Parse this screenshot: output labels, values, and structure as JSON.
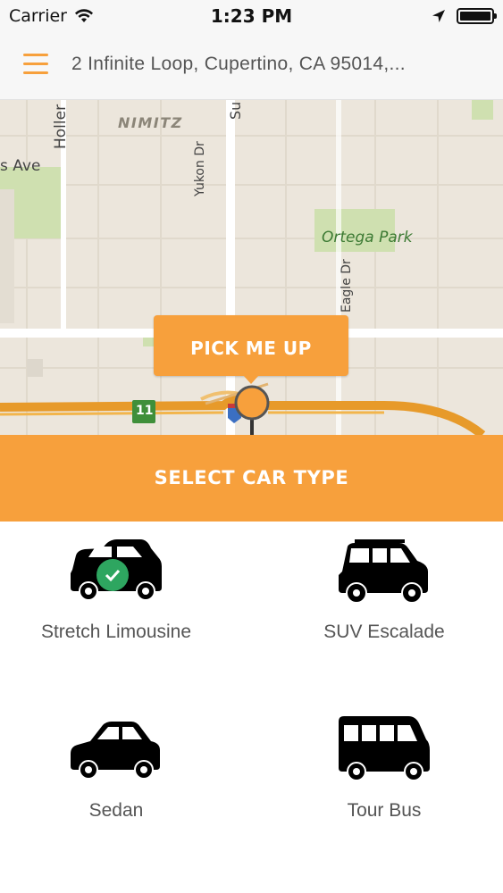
{
  "status_bar": {
    "carrier": "Carrier",
    "time": "1:23 PM"
  },
  "header": {
    "menu_icon": "hamburger-menu-icon",
    "address": "2 Infinite Loop, Cupertino, CA 95014,..."
  },
  "map": {
    "labels": {
      "holler": "Holler",
      "nimitz": "NIMITZ",
      "su": "Su",
      "s_ave": "s Ave",
      "yukon_dr": "Yukon Dr",
      "ortega_park": "Ortega Park",
      "eagle_dr": "Eagle Dr",
      "route_11": "11"
    },
    "pickup_button": "PICK ME UP"
  },
  "select_bar": {
    "label": "SELECT CAR TYPE"
  },
  "cars": [
    {
      "label": "Stretch Limousine",
      "icon": "limousine-icon",
      "selected": true
    },
    {
      "label": "SUV Escalade",
      "icon": "suv-icon",
      "selected": false
    },
    {
      "label": "Sedan",
      "icon": "sedan-icon",
      "selected": false
    },
    {
      "label": "Tour Bus",
      "icon": "tour-bus-icon",
      "selected": false
    }
  ],
  "colors": {
    "accent": "#f7a03c",
    "selected_check": "#2ea660",
    "map_background": "#ece6dc",
    "park_green": "#cfe0b0"
  }
}
